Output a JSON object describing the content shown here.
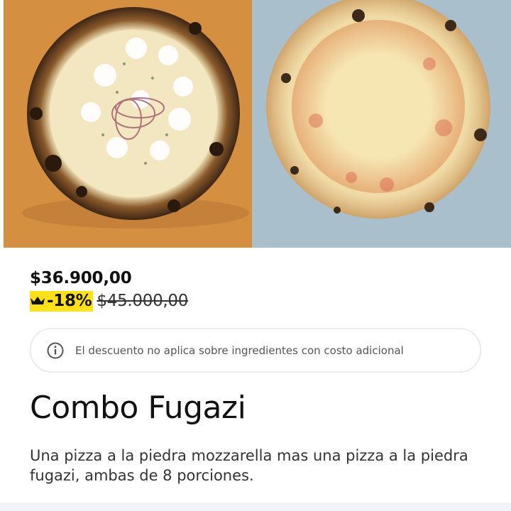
{
  "hero": {
    "image_left": "pizza-fugazi-photo",
    "image_right": "pizza-mozzarella-photo",
    "colors": {
      "left_bg": "#d48f40",
      "right_bg": "#a9c0cc"
    }
  },
  "pricing": {
    "current_price": "$36.900,00",
    "discount_label": "-18%",
    "original_price": "$45.000,00",
    "badge_icon": "crown-icon",
    "badge_color": "#ffe01b"
  },
  "notice": {
    "icon": "info-icon",
    "text": "El descuento no aplica sobre ingredientes con costo adicional"
  },
  "product": {
    "title": "Combo Fugazi",
    "description": "Una pizza a la piedra mozzarella mas una pizza a la piedra fugazi, ambas de 8 porciones."
  }
}
